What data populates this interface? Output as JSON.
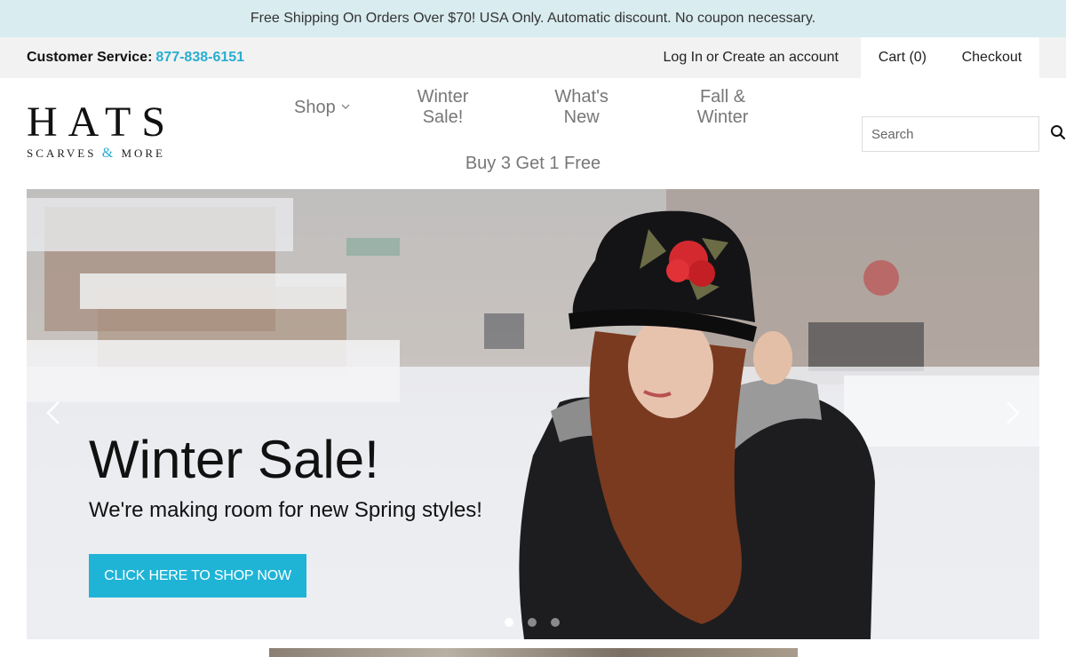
{
  "promo": {
    "text": "Free Shipping On Orders Over $70! USA Only. Automatic discount. No coupon necessary."
  },
  "utility": {
    "customer_service_label": "Customer Service:",
    "phone": "877-838-6151",
    "login": "Log In",
    "or": "or",
    "create_account": "Create an account",
    "cart": "Cart (0)",
    "checkout": "Checkout"
  },
  "logo": {
    "main": "HATS",
    "sub_left": "SCARVES",
    "amp": "&",
    "sub_right": "MORE"
  },
  "nav": {
    "items": [
      {
        "label": "Shop",
        "dropdown": true
      },
      {
        "label": "Winter Sale!"
      },
      {
        "label": "What's New"
      },
      {
        "label": "Fall & Winter"
      },
      {
        "label": "Buy 3 Get 1 Free"
      }
    ]
  },
  "search": {
    "placeholder": "Search",
    "icon": "search-icon"
  },
  "hero": {
    "title": "Winter Sale!",
    "subtitle": "We're making room for new Spring styles!",
    "cta": "CLICK HERE TO SHOP NOW",
    "slides_count": 3,
    "active_slide": 1,
    "prev_icon": "chevron-left-icon",
    "next_icon": "chevron-right-icon"
  },
  "colors": {
    "accent": "#1fb4d6",
    "phone": "#27aed1",
    "promo_bg": "#d9ecef",
    "utility_bg": "#f2f2f2"
  }
}
